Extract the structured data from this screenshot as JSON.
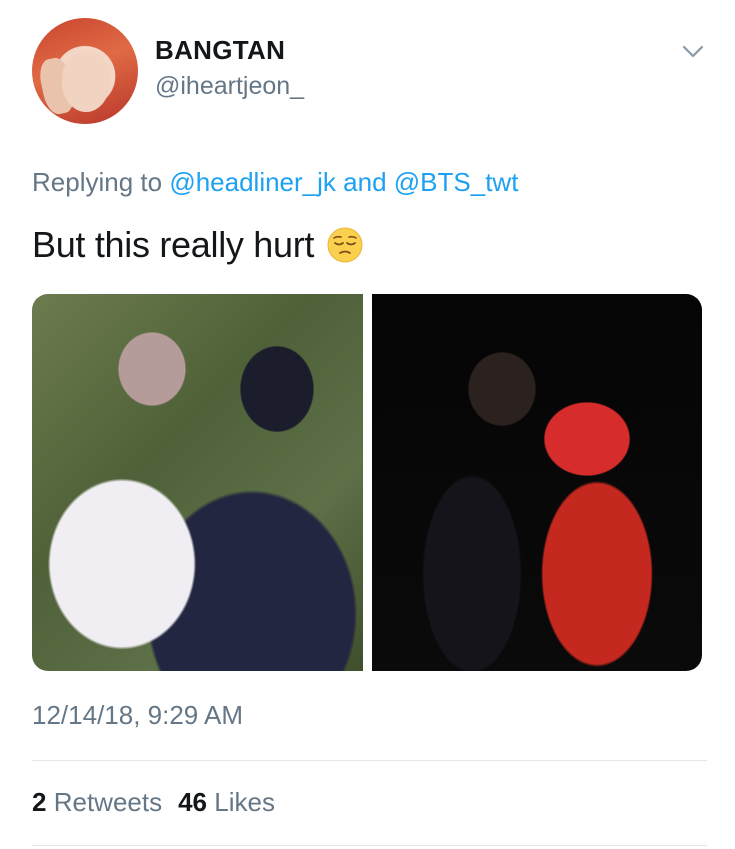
{
  "author": {
    "display_name": "BANGTAN",
    "handle": "@iheartjeon_"
  },
  "reply": {
    "prefix": "Replying to",
    "mention_1": "@headliner_jk",
    "conjunction": "and",
    "mention_2": "@BTS_twt"
  },
  "tweet": {
    "text": "But this really hurt",
    "emoji": "pensive-face-icon"
  },
  "media": {
    "count": 2
  },
  "timestamp": "12/14/18, 9:29 AM",
  "stats": {
    "retweets_count": "2",
    "retweets_label": "Retweets",
    "likes_count": "46",
    "likes_label": "Likes"
  },
  "colors": {
    "link": "#1da1f2",
    "secondary_text": "#657786",
    "primary_text": "#14171a"
  }
}
